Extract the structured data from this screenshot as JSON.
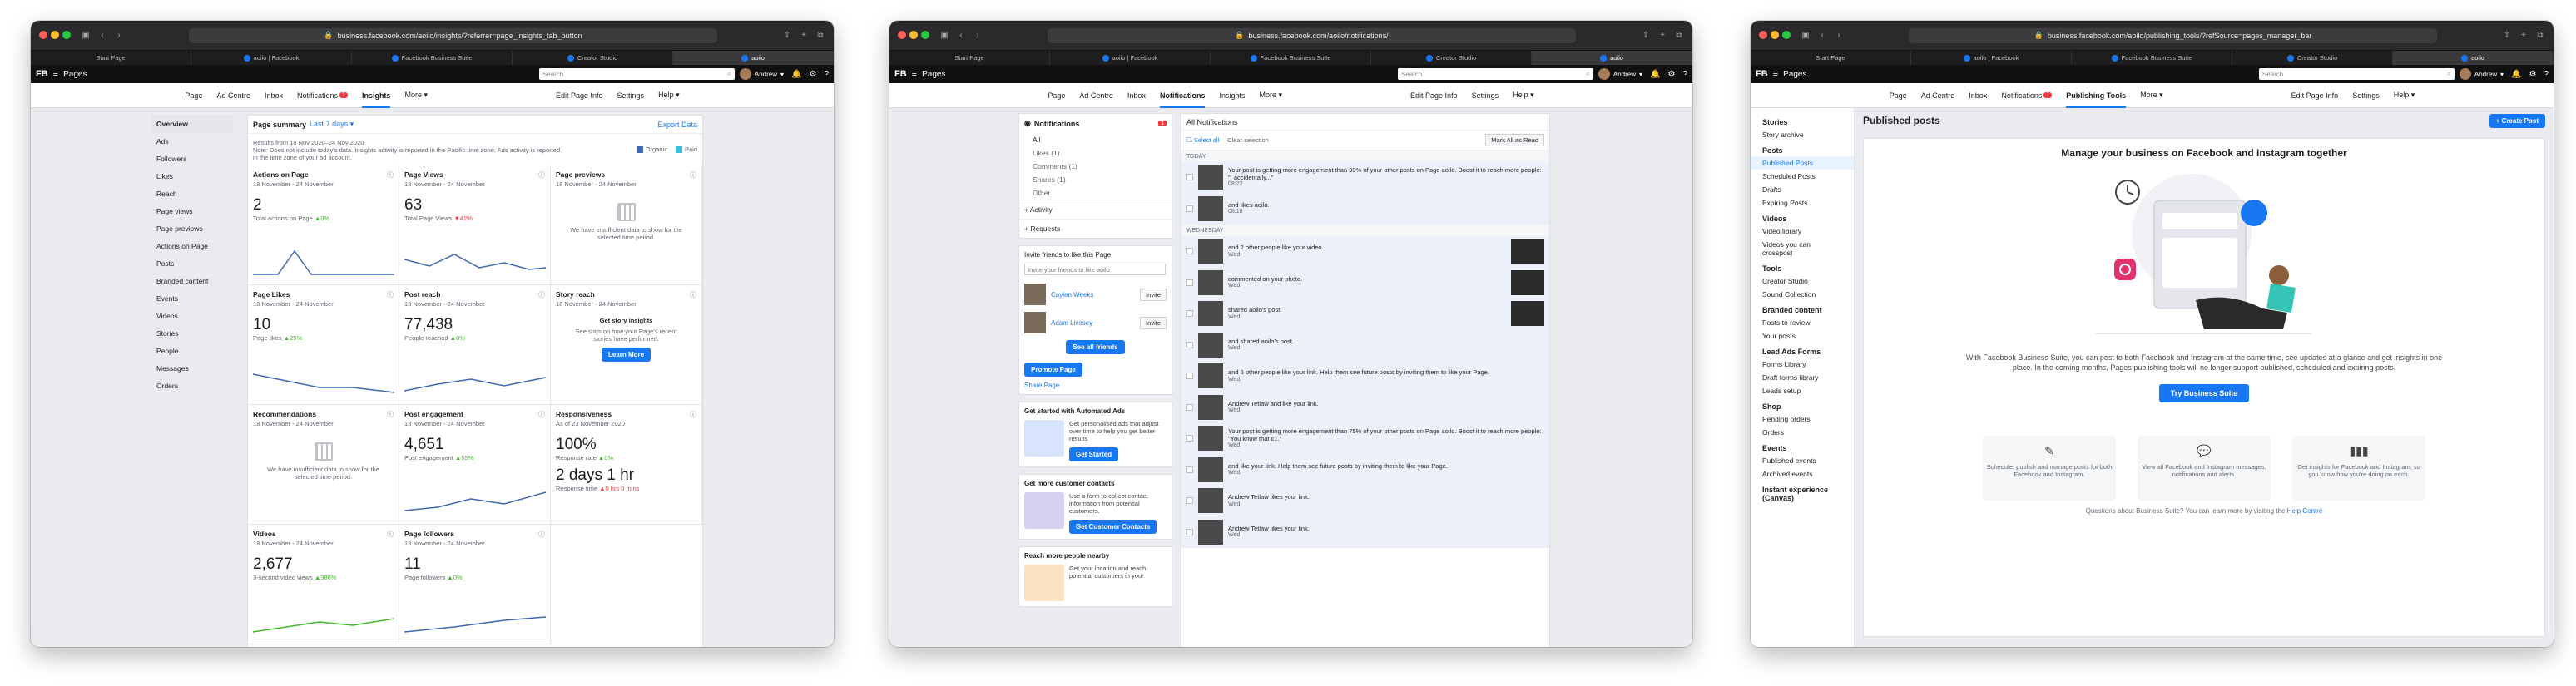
{
  "windows": [
    {
      "url": "business.facebook.com/aoilo/insights/?referrer=page_insights_tab_button",
      "tabs": [
        {
          "label": "Start Page"
        },
        {
          "label": "aoilo | Facebook"
        },
        {
          "label": "Facebook Business Suite"
        },
        {
          "label": "Creator Studio"
        },
        {
          "label": "aoilo"
        }
      ],
      "fb": {
        "logo": "FB",
        "section": "Pages",
        "search_placeholder": "Search",
        "user": "Andrew"
      },
      "nav": [
        {
          "label": "Page"
        },
        {
          "label": "Ad Centre"
        },
        {
          "label": "Inbox"
        },
        {
          "label": "Notifications",
          "badge": "1"
        },
        {
          "label": "Insights"
        },
        {
          "label": "More ▾"
        },
        {
          "label": "Edit Page Info"
        },
        {
          "label": "Settings"
        },
        {
          "label": "Help ▾"
        }
      ],
      "sidebar": [
        "Overview",
        "Ads",
        "Followers",
        "Likes",
        "Reach",
        "Page views",
        "Page previews",
        "Actions on Page",
        "Posts",
        "Branded content",
        "Events",
        "Videos",
        "Stories",
        "People",
        "Messages",
        "Orders"
      ],
      "summary": {
        "title": "Page summary",
        "range": "Last 7 days ▾",
        "export": "Export Data",
        "note1": "Results from 18 Nov 2020–24 Nov 2020",
        "note2": "Note: Does not include today's data. Insights activity is reported in the Pacific time zone. Ads activity is reported",
        "note3": "in the time zone of your ad account.",
        "legend_organic": "Organic",
        "legend_paid": "Paid"
      },
      "cards": [
        {
          "title": "Actions on Page",
          "date": "18 November - 24 November",
          "value": "2",
          "sub": "Total actions on Page",
          "delta": "▲0%"
        },
        {
          "title": "Page Views",
          "date": "18 November - 24 November",
          "value": "63",
          "sub": "Total Page Views",
          "delta": "▼42%"
        },
        {
          "title": "Page previews",
          "date": "18 November - 24 November",
          "nodata": "We have insufficient data to show for the selected time period."
        },
        {
          "title": "Page Likes",
          "date": "18 November - 24 November",
          "value": "10",
          "sub": "Page likes",
          "delta": "▲25%"
        },
        {
          "title": "Post reach",
          "date": "18 November - 24 November",
          "value": "77,438",
          "sub": "People reached",
          "delta": "▲0%"
        },
        {
          "title": "Story reach",
          "date": "18 November - 24 November",
          "story_t": "Get story insights",
          "story_d": "See stats on how your Page's recent stories have performed.",
          "story_btn": "Learn More"
        },
        {
          "title": "Recommendations",
          "date": "18 November - 24 November",
          "nodata": "We have insufficient data to show for the selected time period."
        },
        {
          "title": "Post engagement",
          "date": "18 November - 24 November",
          "value": "4,651",
          "sub": "Post engagement",
          "delta": "▲55%"
        },
        {
          "title": "Responsiveness",
          "date": "As of 23 November 2020",
          "value": "100%",
          "sub": "Response rate",
          "delta": "▲0%",
          "value2": "2 days 1 hr",
          "sub2": "Response time",
          "delta2": "▲0 hrs 0 mins"
        },
        {
          "title": "Videos",
          "date": "18 November - 24 November",
          "value": "2,677",
          "sub": "3-second video views",
          "delta": "▲386%"
        },
        {
          "title": "Page followers",
          "date": "18 November - 24 November",
          "value": "11",
          "sub": "Page followers",
          "delta": "▲0%"
        }
      ]
    },
    {
      "url": "business.facebook.com/aoilo/notifications/",
      "tabs": [
        {
          "label": "Start Page"
        },
        {
          "label": "aoilo | Facebook"
        },
        {
          "label": "Facebook Business Suite"
        },
        {
          "label": "Creator Studio"
        },
        {
          "label": "aoilo"
        }
      ],
      "fb": {
        "logo": "FB",
        "section": "Pages",
        "search_placeholder": "Search",
        "user": "Andrew"
      },
      "nav": [
        {
          "label": "Page"
        },
        {
          "label": "Ad Centre"
        },
        {
          "label": "Inbox"
        },
        {
          "label": "Notifications"
        },
        {
          "label": "Insights"
        },
        {
          "label": "More ▾"
        },
        {
          "label": "Edit Page Info"
        },
        {
          "label": "Settings"
        },
        {
          "label": "Help ▾"
        }
      ],
      "notif": {
        "title": "Notifications",
        "count": "1",
        "filters": [
          "All",
          "Likes (1)",
          "Comments (1)",
          "Shares (1)",
          "Other"
        ],
        "activity": "Activity",
        "requests": "Requests"
      },
      "invite": {
        "title": "Invite friends to like this Page",
        "placeholder": "Invite your friends to like aoilo",
        "friends": [
          "Caylen Weeks",
          "Adam Livesey"
        ],
        "invite_label": "Invite",
        "see_all": "See all friends",
        "promote": "Promote Page",
        "share": "Share Page"
      },
      "promos": [
        {
          "title": "Get started with Automated Ads",
          "text": "Get personalised ads that adjust over time to help you get better results",
          "btn": "Get Started"
        },
        {
          "title": "Get more customer contacts",
          "text": "Use a form to collect contact information from potential customers.",
          "btn": "Get Customer Contacts"
        },
        {
          "title": "Reach more people nearby",
          "text": "Get your location and reach potential customers in your"
        }
      ],
      "feed": {
        "title": "All Notifications",
        "select_all": "Select all",
        "clear": "Clear selection",
        "mark_all": "Mark All as Read",
        "today": "TODAY",
        "wednesday": "WEDNESDAY",
        "items": [
          {
            "text": "Your post is getting more engagement than 90% of your other posts on Page aoilo. Boost it to reach more people: \"I accidentally...\"",
            "time": "08:22"
          },
          {
            "text": "and likes aoilo.",
            "time": "08:18"
          },
          {
            "text": "and 2 other people like your video.",
            "time": "Wed"
          },
          {
            "text": "commented on your photo.",
            "time": "Wed"
          },
          {
            "text": "shared aoilo's post.",
            "time": "Wed"
          },
          {
            "text": "and shared aoilo's post.",
            "time": "Wed"
          },
          {
            "text": "and 6 other people like your link. Help them see future posts by inviting them to like your Page.",
            "time": "Wed"
          },
          {
            "text": "Andrew Tetlaw and like your link.",
            "time": "Wed"
          },
          {
            "text": "Your post is getting more engagement than 75% of your other posts on Page aoilo. Boost it to reach more people: \"You know that c...\"",
            "time": "Wed"
          },
          {
            "text": "and like your link. Help them see future posts by inviting them to like your Page.",
            "time": "Wed"
          },
          {
            "text": "Andrew Tetlaw likes your link.",
            "time": "Wed"
          },
          {
            "text": "Andrew Tetlaw likes your link.",
            "time": "Wed"
          }
        ]
      }
    },
    {
      "url": "business.facebook.com/aoilo/publishing_tools/?refSource=pages_manager_bar",
      "tabs": [
        {
          "label": "Start Page"
        },
        {
          "label": "aoilo | Facebook"
        },
        {
          "label": "Facebook Business Suite"
        },
        {
          "label": "Creator Studio"
        },
        {
          "label": "aoilo"
        }
      ],
      "fb": {
        "logo": "FB",
        "section": "Pages",
        "search_placeholder": "Search",
        "user": "Andrew"
      },
      "nav": [
        {
          "label": "Page"
        },
        {
          "label": "Ad Centre"
        },
        {
          "label": "Inbox"
        },
        {
          "label": "Notifications",
          "badge": "1"
        },
        {
          "label": "Publishing Tools"
        },
        {
          "label": "More ▾"
        },
        {
          "label": "Edit Page Info"
        },
        {
          "label": "Settings"
        },
        {
          "label": "Help ▾"
        }
      ],
      "sidebar": [
        {
          "group": "Stories",
          "items": [
            "Story archive"
          ]
        },
        {
          "group": "Posts",
          "items": [
            "Published Posts",
            "Scheduled Posts",
            "Drafts",
            "Expiring Posts"
          ]
        },
        {
          "group": "Videos",
          "items": [
            "Video library",
            "Videos you can crosspost"
          ]
        },
        {
          "group": "Tools",
          "items": [
            "Creator Studio",
            "Sound Collection"
          ]
        },
        {
          "group": "Branded content",
          "items": [
            "Posts to review",
            "Your posts"
          ]
        },
        {
          "group": "Lead Ads Forms",
          "items": [
            "Forms Library",
            "Draft forms library",
            "Leads setup"
          ]
        },
        {
          "group": "Shop",
          "items": [
            "Pending orders",
            "Orders"
          ]
        },
        {
          "group": "Events",
          "items": [
            "Published events",
            "Archived events"
          ]
        },
        {
          "group": "Instant experience (Canvas)",
          "items": []
        }
      ],
      "publishing": {
        "heading": "Published posts",
        "create": "+ Create Post",
        "title": "Manage your business on Facebook and Instagram together",
        "desc": "With Facebook Business Suite, you can post to both Facebook and Instagram at the same time, see updates at a glance and get insights in one place. In the coming months, Pages publishing tools will no longer support published, scheduled and expiring posts.",
        "cta": "Try Business Suite",
        "features": [
          {
            "icon": "edit-icon",
            "text": "Schedule, publish and manage posts for both Facebook and Instagram."
          },
          {
            "icon": "message-icon",
            "text": "View all Facebook and Instagram messages, notifications and alerts."
          },
          {
            "icon": "chart-icon",
            "text": "Get insights for Facebook and Instagram, so you know how you're doing on each."
          }
        ],
        "question": "Questions about Business Suite? You can learn more by visiting the",
        "help": "Help Centre"
      }
    }
  ],
  "colors": {
    "fb_blue": "#1877f2",
    "organic": "#4267b2",
    "paid": "#3dbdd5",
    "alert": "#fa383e",
    "up": "#42b72a"
  }
}
